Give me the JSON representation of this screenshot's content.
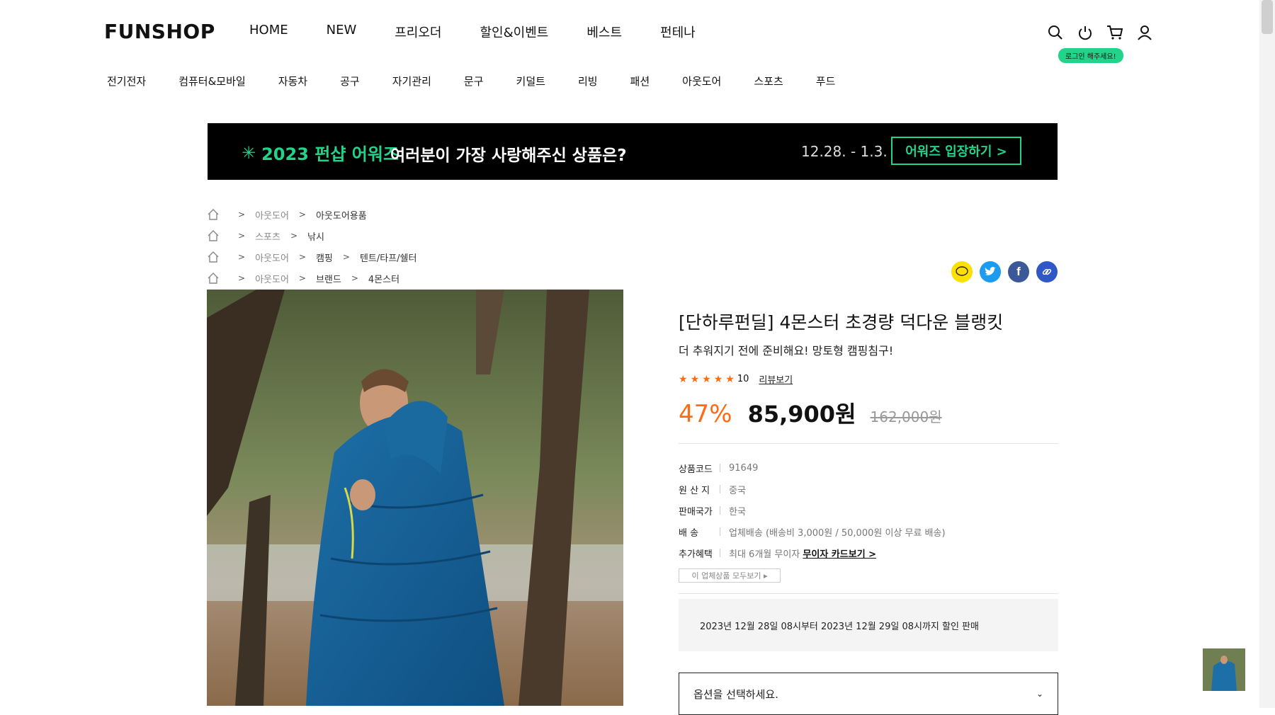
{
  "header": {
    "logo": "FUNSHOP",
    "nav": [
      "HOME",
      "NEW",
      "프리오더",
      "할인&이벤트",
      "베스트",
      "펀테나"
    ],
    "login_tooltip": "로그인 해주세요!",
    "icons": [
      "search-icon",
      "power-icon",
      "cart-icon",
      "user-icon"
    ]
  },
  "categories": [
    "전기전자",
    "컴퓨터&모바일",
    "자동차",
    "공구",
    "자기관리",
    "문구",
    "키덜트",
    "리빙",
    "패션",
    "아웃도어",
    "스포츠",
    "푸드"
  ],
  "banner": {
    "title": "2023 펀샵 어워즈",
    "subtitle": "여러분이 가장 사랑해주신 상품은?",
    "date": "12.28. - 1.3.",
    "button": "어워즈 입장하기 >"
  },
  "breadcrumbs": [
    [
      "아웃도어",
      "아웃도어용품"
    ],
    [
      "스포츠",
      "낚시"
    ],
    [
      "아웃도어",
      "캠핑",
      "텐트/타프/쉘터"
    ],
    [
      "아웃도어",
      "브랜드",
      "4몬스터"
    ]
  ],
  "share": [
    "kakao-icon",
    "twitter-icon",
    "facebook-icon",
    "link-icon"
  ],
  "product": {
    "title": "[단하루펀딜] 4몬스터 초경량 덕다운 블랭킷",
    "subtitle": "더 추워지기 전에 준비해요! 망토형 캠핑침구!",
    "rating_stars": 5,
    "rating_count": "10",
    "review_link": "리뷰보기",
    "discount": "47%",
    "price": "85,900원",
    "original_price": "162,000원",
    "info": [
      {
        "key": "상품코드",
        "value": "91649"
      },
      {
        "key": "원 산 지",
        "value": "중국"
      },
      {
        "key": "판매국가",
        "value": "한국"
      },
      {
        "key": "배 송",
        "value": "업체배송 (배송비 3,000원 / 50,000원 이상 무료 배송)"
      },
      {
        "key": "추가혜택",
        "value": "최대 6개월 무이자",
        "link": "무이자 카드보기 >"
      }
    ],
    "all_products_button": "이 업체상품 모두보기 ▸",
    "sale_notice": "2023년 12월 28일 08시부터 2023년 12월 29일 08시까지 할인 판매",
    "option_placeholder": "옵션을 선택하세요."
  },
  "colors": {
    "accent": "#22d38a",
    "discount": "#ff6a13"
  }
}
